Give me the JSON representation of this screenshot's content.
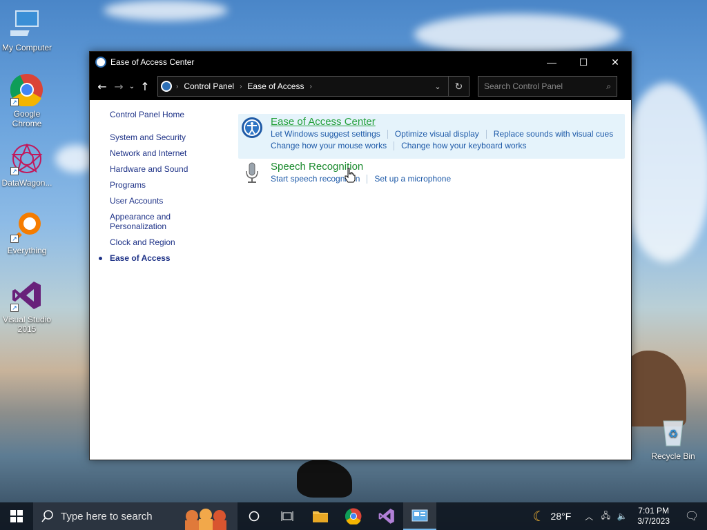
{
  "desktop": {
    "icons": [
      {
        "label": "My Computer"
      },
      {
        "label": "Google Chrome"
      },
      {
        "label": "DataWagon..."
      },
      {
        "label": "Everything"
      },
      {
        "label": "Visual Studio 2015"
      },
      {
        "label": "Recycle Bin"
      }
    ]
  },
  "window": {
    "title": "Ease of Access Center",
    "controls": {
      "minimize": "—",
      "maximize": "☐",
      "close": "✕"
    }
  },
  "address": {
    "crumbs": [
      "Control Panel",
      "Ease of Access"
    ],
    "search_placeholder": "Search Control Panel"
  },
  "leftnav": {
    "home": "Control Panel Home",
    "items": [
      "System and Security",
      "Network and Internet",
      "Hardware and Sound",
      "Programs",
      "User Accounts",
      "Appearance and Personalization",
      "Clock and Region",
      "Ease of Access"
    ]
  },
  "sections": [
    {
      "title": "Ease of Access Center",
      "links_row1": [
        "Let Windows suggest settings",
        "Optimize visual display",
        "Replace sounds with visual cues"
      ],
      "links_row2": [
        "Change how your mouse works",
        "Change how your keyboard works"
      ]
    },
    {
      "title": "Speech Recognition",
      "links_row1": [
        "Start speech recognition",
        "Set up a microphone"
      ]
    }
  ],
  "taskbar": {
    "search_text": "Type here to search",
    "weather": "28°F",
    "time": "7:01 PM",
    "date": "3/7/2023"
  },
  "colors": {
    "link": "#1e5aa8",
    "section_title": "#1a8a2d",
    "nav_text": "#1e3287",
    "highlight": "#e5f3fb"
  }
}
